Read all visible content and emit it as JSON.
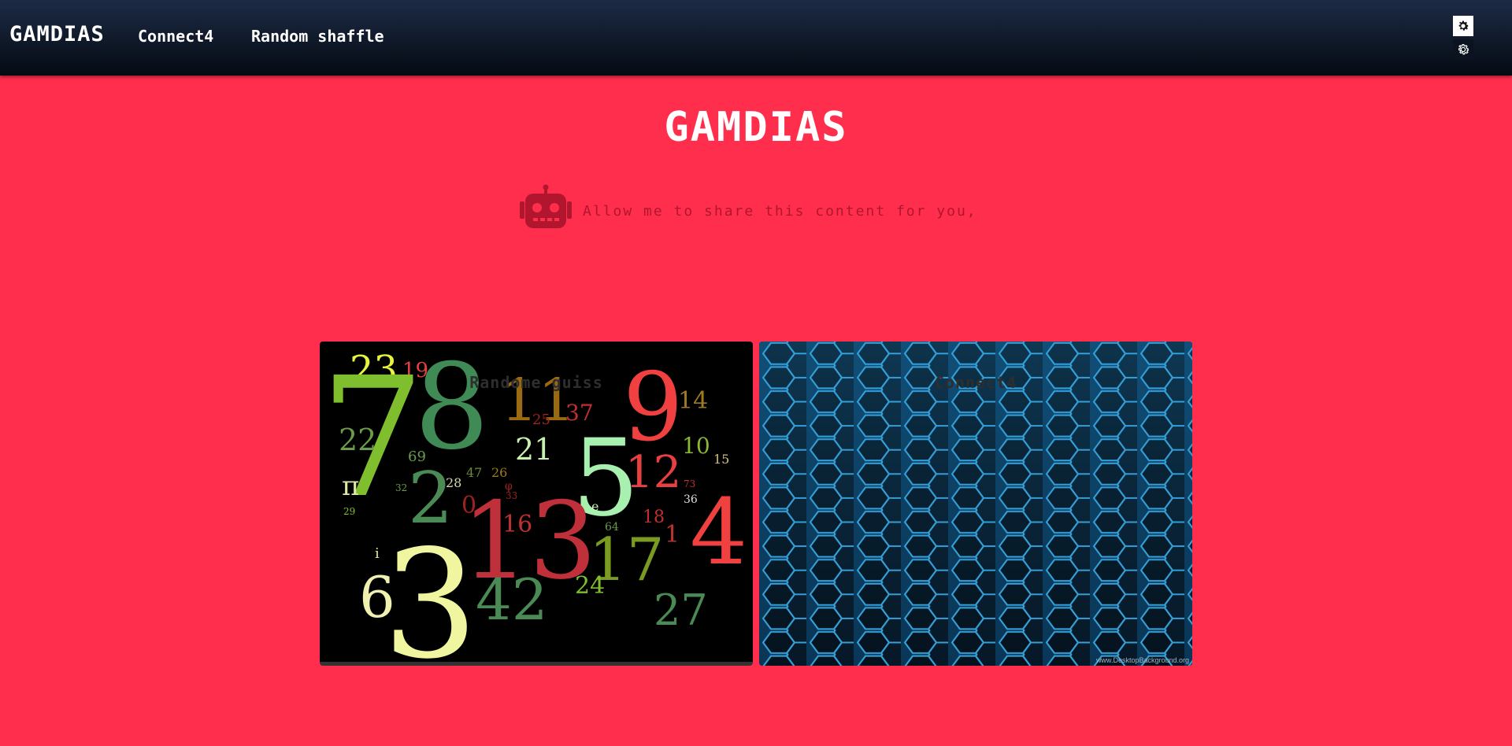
{
  "navbar": {
    "brand": "GAMDIAS",
    "links": [
      {
        "label": "Connect4"
      },
      {
        "label": "Random shaffle"
      }
    ],
    "settings_buttons": [
      {
        "icon": "gear-icon",
        "theme": "light"
      },
      {
        "icon": "gear-icon",
        "theme": "dark"
      }
    ]
  },
  "hero": {
    "title": "GAMDIAS",
    "bot_icon": "robot-icon",
    "message": "Allow me to share this content for you,"
  },
  "cards": [
    {
      "title": "Randome guiss"
    },
    {
      "title": "Connect4",
      "watermark": "www.DesktopBackground.org"
    }
  ],
  "numbers_art": [
    {
      "t": "23",
      "c": "#e8f43c"
    },
    {
      "t": "19",
      "c": "#e24040"
    },
    {
      "t": "8",
      "c": "#3f8a55"
    },
    {
      "t": "7",
      "c": "#7fbf2e"
    },
    {
      "t": "11",
      "c": "#9a6a12"
    },
    {
      "t": "25",
      "c": "#a0221f"
    },
    {
      "t": "37",
      "c": "#c03030"
    },
    {
      "t": "9",
      "c": "#f04040"
    },
    {
      "t": "14",
      "c": "#a07a20"
    },
    {
      "t": "22",
      "c": "#6a9a4a"
    },
    {
      "t": "69",
      "c": "#6a9a4a"
    },
    {
      "t": "21",
      "c": "#c8f0b0"
    },
    {
      "t": "10",
      "c": "#8ab830"
    },
    {
      "t": "15",
      "c": "#d0c080"
    },
    {
      "t": "π",
      "c": "#dfe8a0"
    },
    {
      "t": "2",
      "c": "#4a8a55"
    },
    {
      "t": "47",
      "c": "#6a8a3a"
    },
    {
      "t": "26",
      "c": "#a07a20"
    },
    {
      "t": "5",
      "c": "#a8f0b0"
    },
    {
      "t": "12",
      "c": "#e84040"
    },
    {
      "t": "73",
      "c": "#c03030"
    },
    {
      "t": "28",
      "c": "#d8d8b0"
    },
    {
      "t": "32",
      "c": "#6a9a4a"
    },
    {
      "t": "29",
      "c": "#7fbf2e"
    },
    {
      "t": "0",
      "c": "#a0221f"
    },
    {
      "t": "13",
      "c": "#c0303a"
    },
    {
      "t": "16",
      "c": "#c03030"
    },
    {
      "t": "e",
      "c": "#c8f0b0"
    },
    {
      "t": "64",
      "c": "#6a9a4a"
    },
    {
      "t": "18",
      "c": "#c03030"
    },
    {
      "t": "36",
      "c": "#e0e0e0"
    },
    {
      "t": "4",
      "c": "#f04040"
    },
    {
      "t": "1",
      "c": "#c03030"
    },
    {
      "t": "i",
      "c": "#dfe8a0"
    },
    {
      "t": "17",
      "c": "#7a9a20"
    },
    {
      "t": "6",
      "c": "#f0f0b0"
    },
    {
      "t": "3",
      "c": "#f0f6a0"
    },
    {
      "t": "42",
      "c": "#4a8a55"
    },
    {
      "t": "24",
      "c": "#7fbf2e"
    },
    {
      "t": "27",
      "c": "#4a8a55"
    },
    {
      "t": "φ",
      "c": "#a0221f"
    },
    {
      "t": "33",
      "c": "#a0221f"
    }
  ]
}
